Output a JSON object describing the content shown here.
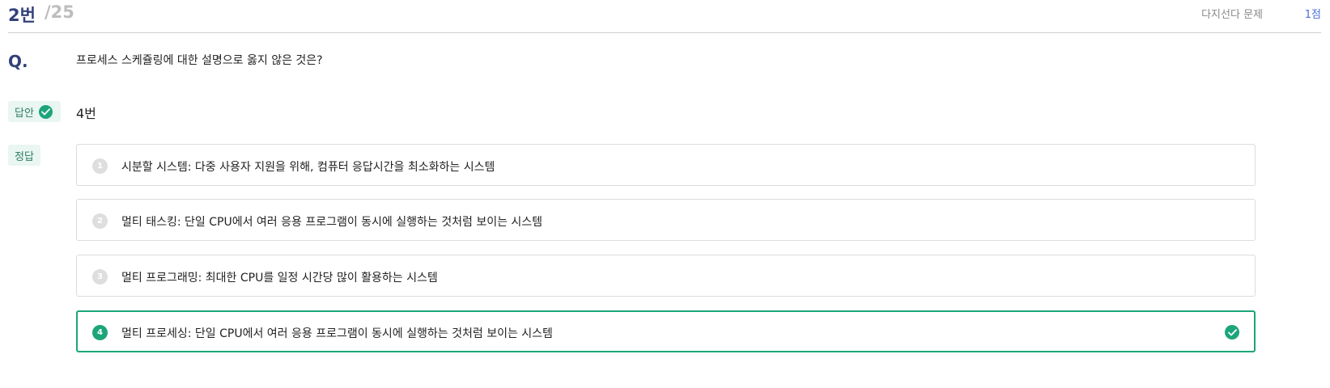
{
  "header": {
    "question_number": "2번",
    "question_total": "/25",
    "question_type": "다지선다 문제",
    "score": "1점"
  },
  "question": {
    "label": "Q.",
    "text": "프로세스 스케쥴링에 대한 설명으로 옳지 않은 것은?"
  },
  "answer": {
    "badge_label": "답안",
    "value": "4번"
  },
  "correct": {
    "badge_label": "정답"
  },
  "options": [
    {
      "number": "1",
      "text": "시분할 시스템: 다중 사용자 지원을 위해, 컴퓨터 응답시간을 최소화하는 시스템"
    },
    {
      "number": "2",
      "text": "멀티 태스킹: 단일 CPU에서 여러 응용 프로그램이 동시에 실행하는 것처럼 보이는 시스템"
    },
    {
      "number": "3",
      "text": "멀티 프로그래밍: 최대한 CPU를 일정 시간당 많이 활용하는 시스템"
    },
    {
      "number": "4",
      "text": "멀티 프로세싱: 단일 CPU에서 여러 응용 프로그램이 동시에 실행하는 것처럼 보이는 시스템"
    }
  ],
  "selected_option": "4",
  "colors": {
    "accent": "#1da57a",
    "title": "#33417a",
    "score": "#4a6fdc"
  }
}
